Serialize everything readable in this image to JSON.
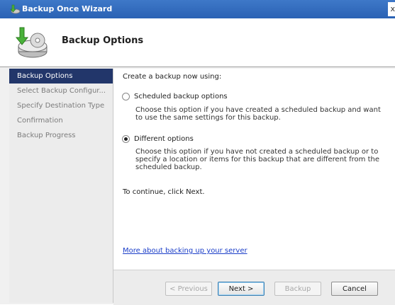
{
  "window": {
    "title": "Backup Once Wizard",
    "close_label": "x"
  },
  "header": {
    "title": "Backup Options"
  },
  "nav": {
    "items": [
      {
        "label": "Backup Options"
      },
      {
        "label": "Select Backup Configur..."
      },
      {
        "label": "Specify Destination Type"
      },
      {
        "label": "Confirmation"
      },
      {
        "label": "Backup Progress"
      }
    ]
  },
  "content": {
    "prompt": "Create a backup now using:",
    "options": [
      {
        "label": "Scheduled backup options",
        "selected": false,
        "description": "Choose this option if you have created a scheduled backup and want to use the same settings for this backup."
      },
      {
        "label": "Different options",
        "selected": true,
        "description": "Choose this option if you have not created a scheduled backup or to specify a location or items for this backup that are different from the scheduled backup."
      }
    ],
    "continue_text": "To continue, click Next.",
    "help_link": "More about backing up your server"
  },
  "buttons": {
    "previous": "< Previous",
    "next": "Next >",
    "backup": "Backup",
    "cancel": "Cancel"
  },
  "colors": {
    "titlebar": "#2a62b4",
    "nav_selected": "#22366a",
    "link": "#1a3dc8"
  }
}
